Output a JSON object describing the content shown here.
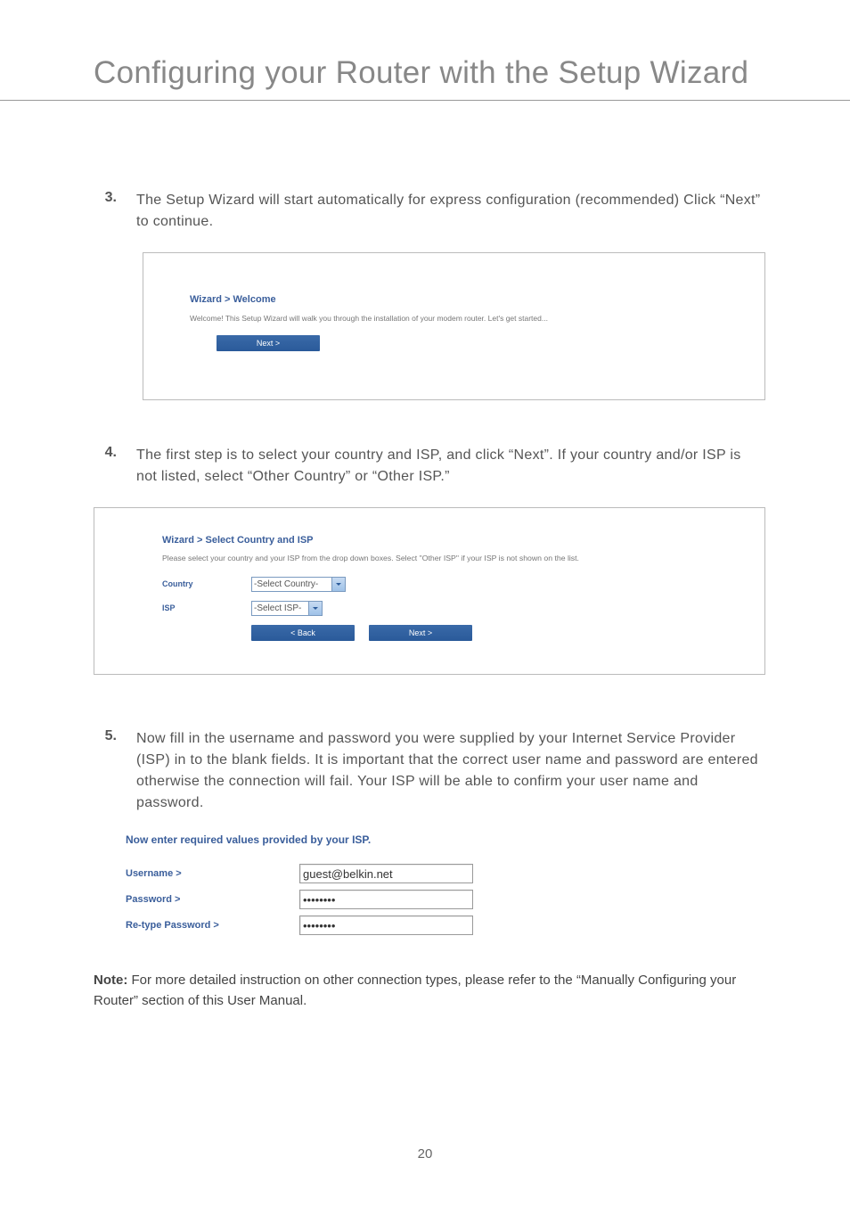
{
  "page": {
    "title": "Configuring your Router with the Setup Wizard",
    "number": "20"
  },
  "steps": {
    "s3": {
      "num": "3.",
      "text": "The Setup Wizard will start automatically for express configuration (recommended) Click “Next” to continue."
    },
    "s4": {
      "num": "4.",
      "text": "The first step is to select your country and ISP, and click “Next”. If your country and/or ISP is not listed, select “Other Country” or “Other ISP.”"
    },
    "s5": {
      "num": "5.",
      "text": "Now fill in the username and password you were supplied by your Internet Service Provider (ISP) in to the blank fields. It is important that the correct user name and password are entered otherwise the connection will fail. Your ISP will be able to confirm your user name and password."
    }
  },
  "panel1": {
    "breadcrumb": "Wizard > Welcome",
    "description": "Welcome! This Setup Wizard will walk you through the installation of your modem router. Let's get started...",
    "next_label": "Next >"
  },
  "panel2": {
    "breadcrumb": "Wizard > Select Country and ISP",
    "description": "Please select your country and your ISP from the drop down boxes. Select \"Other ISP\" if your ISP is not shown on the list.",
    "country_label": "Country",
    "country_value": "-Select Country-",
    "isp_label": "ISP",
    "isp_value": "-Select ISP-",
    "back_label": "< Back",
    "next_label": "Next >"
  },
  "credentials": {
    "title": "Now enter required values provided by your ISP.",
    "username_label": "Username >",
    "username_value": "guest@belkin.net",
    "password_label": "Password >",
    "password_value": "••••••••",
    "retype_label": "Re-type Password >",
    "retype_value": "••••••••"
  },
  "note": {
    "bold": "Note:",
    "text": " For more detailed instruction on other connection types, please refer to the “Manually Configuring your Router” section of this User Manual."
  }
}
